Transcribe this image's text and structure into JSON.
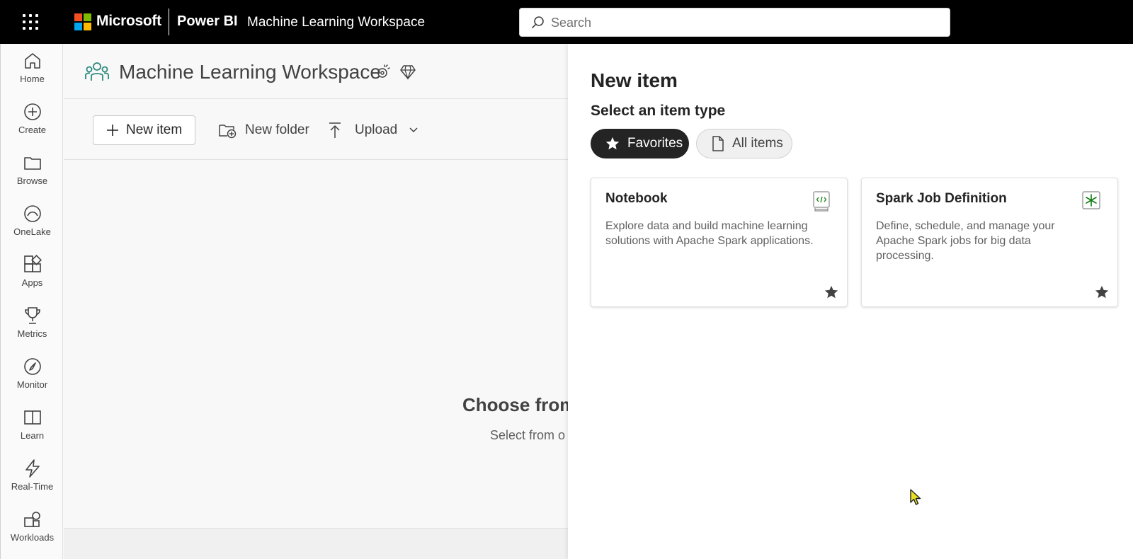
{
  "topbar": {
    "brand": "Microsoft",
    "product": "Power BI",
    "workspace_crumb": "Machine Learning Workspace",
    "search_placeholder": "Search"
  },
  "nav": {
    "items": [
      {
        "label": "Home",
        "icon": "home-icon"
      },
      {
        "label": "Create",
        "icon": "create-plus-icon"
      },
      {
        "label": "Browse",
        "icon": "folder-icon"
      },
      {
        "label": "OneLake",
        "icon": "onelake-icon"
      },
      {
        "label": "Apps",
        "icon": "apps-icon"
      },
      {
        "label": "Metrics",
        "icon": "trophy-icon"
      },
      {
        "label": "Monitor",
        "icon": "monitor-icon"
      },
      {
        "label": "Learn",
        "icon": "book-icon"
      },
      {
        "label": "Real-Time",
        "icon": "lightning-icon"
      },
      {
        "label": "Workloads",
        "icon": "workloads-icon"
      }
    ]
  },
  "workspace": {
    "title": "Machine Learning Workspace",
    "toolbar": {
      "new_item": "New item",
      "new_folder": "New folder",
      "upload": "Upload"
    },
    "empty_title": "Choose from",
    "empty_subtitle": "Select from o"
  },
  "panel": {
    "title": "New item",
    "subtitle": "Select an item type",
    "filters": {
      "favorites": "Favorites",
      "all_items": "All items",
      "active": "Favorites"
    },
    "cards": [
      {
        "title": "Notebook",
        "description": "Explore data and build machine learning solutions with Apache Spark applications.",
        "icon": "notebook-icon",
        "favorited": true
      },
      {
        "title": "Spark Job Definition",
        "description": "Define, schedule, and manage your Apache Spark jobs for big data processing.",
        "icon": "spark-job-icon",
        "favorited": true
      }
    ]
  },
  "colors": {
    "topbar_bg": "#000000",
    "accent_green": "#107c10",
    "workspace_icon": "#2a8a7e",
    "pill_active_bg": "#242424"
  }
}
